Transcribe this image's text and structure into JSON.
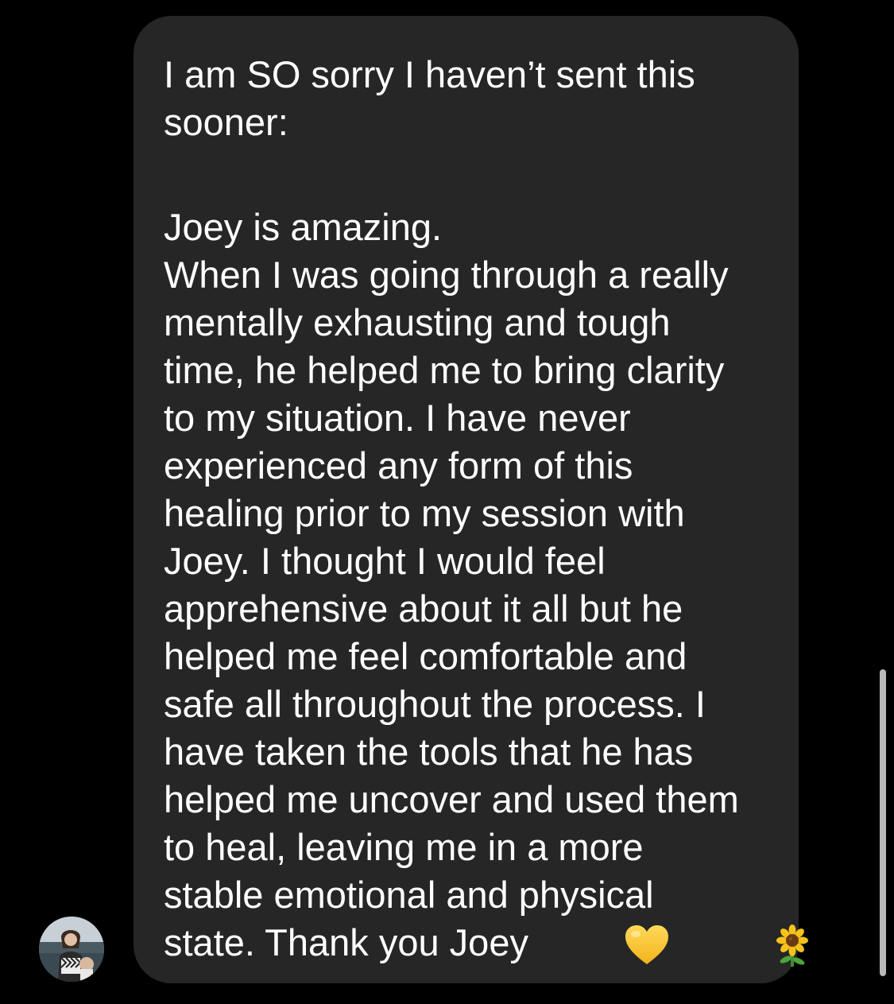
{
  "message": {
    "lines": [
      "I am SO sorry I haven’t sent this",
      "sooner:",
      "",
      "Joey is amazing.",
      "When I was going through a really",
      "mentally exhausting and tough",
      "time, he helped me to bring clarity",
      "to my situation. I have never",
      "experienced any form of this",
      "healing prior to my session with",
      "Joey. I thought I would feel",
      "apprehensive about it all but he",
      "helped me feel comfortable and",
      "safe all throughout the process. I",
      "have taken the tools that he has",
      "helped me uncover and used them",
      "to heal, leaving me in a more",
      "stable emotional and physical"
    ],
    "last_line": "state. Thank you Joey",
    "emojis": [
      "yellow-heart-icon",
      "sunflower-icon"
    ]
  },
  "colors": {
    "background": "#000000",
    "bubble": "#262626",
    "text": "#ffffff",
    "scrollbar": "#b9b9b9"
  },
  "sender": {
    "avatar_icon": "profile-photo"
  }
}
